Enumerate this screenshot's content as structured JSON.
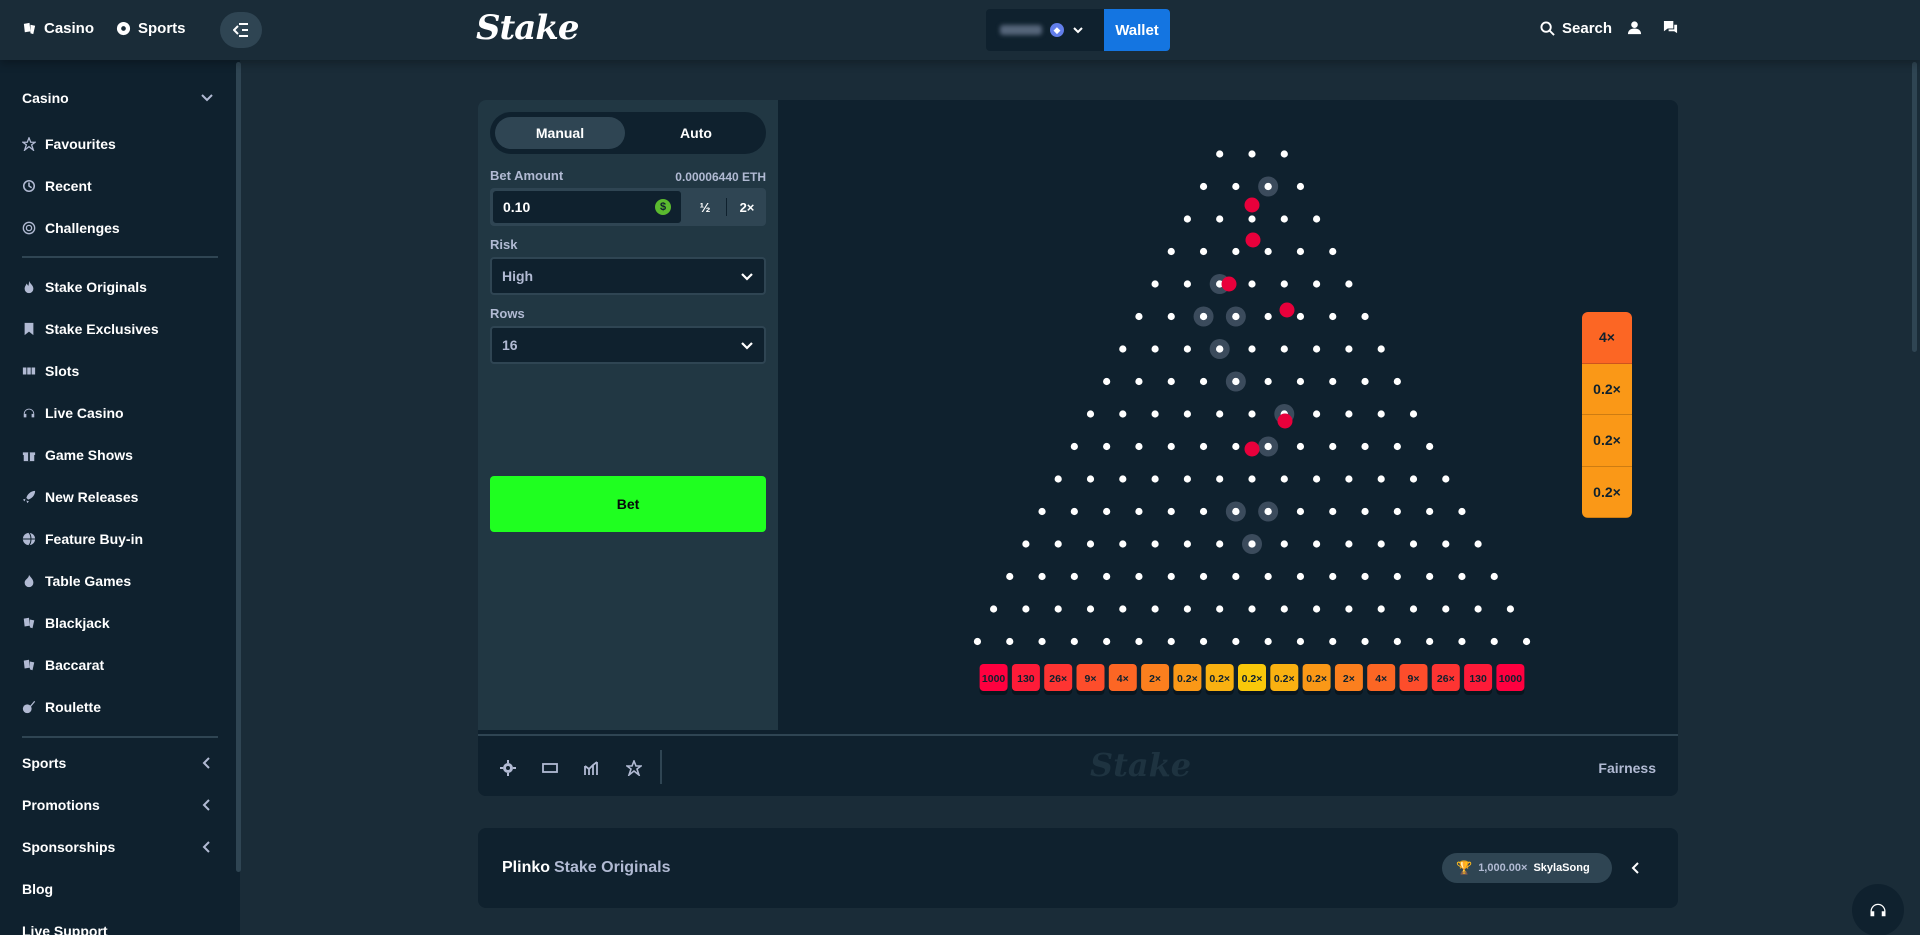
{
  "topbar": {
    "casino_label": "Casino",
    "sports_label": "Sports",
    "logo_text": "Stake",
    "wallet_label": "Wallet",
    "search_label": "Search"
  },
  "sidebar": {
    "section_label": "Casino",
    "group1": [
      {
        "label": "Favourites",
        "icon": "star-icon"
      },
      {
        "label": "Recent",
        "icon": "clock-icon"
      },
      {
        "label": "Challenges",
        "icon": "target-icon"
      }
    ],
    "group2": [
      {
        "label": "Stake Originals",
        "icon": "fire-icon"
      },
      {
        "label": "Stake Exclusives",
        "icon": "bookmark-icon"
      },
      {
        "label": "Slots",
        "icon": "slots-icon"
      },
      {
        "label": "Live Casino",
        "icon": "headset-icon"
      },
      {
        "label": "Game Shows",
        "icon": "gift-icon"
      },
      {
        "label": "New Releases",
        "icon": "rocket-icon"
      },
      {
        "label": "Feature Buy-in",
        "icon": "globe-icon"
      },
      {
        "label": "Table Games",
        "icon": "flame-icon"
      },
      {
        "label": "Blackjack",
        "icon": "cards-icon"
      },
      {
        "label": "Baccarat",
        "icon": "cards-icon"
      },
      {
        "label": "Roulette",
        "icon": "roulette-icon"
      }
    ],
    "group3": [
      {
        "label": "Sports"
      },
      {
        "label": "Promotions"
      },
      {
        "label": "Sponsorships"
      },
      {
        "label": "Blog"
      },
      {
        "label": "Live Support"
      }
    ]
  },
  "bet_panel": {
    "mode_manual": "Manual",
    "mode_auto": "Auto",
    "bet_amount_label": "Bet Amount",
    "bet_amount_crypto": "0.00006440 ETH",
    "bet_amount_value": "0.10",
    "coin_symbol": "$",
    "half_label": "½",
    "double_label": "2×",
    "risk_label": "Risk",
    "risk_value": "High",
    "rows_label": "Rows",
    "rows_value": "16",
    "bet_button": "Bet"
  },
  "plinko": {
    "rows": 16,
    "multipliers": [
      "1000",
      "130",
      "26×",
      "9×",
      "4×",
      "2×",
      "0.2×",
      "0.2×",
      "0.2×",
      "0.2×",
      "0.2×",
      "2×",
      "4×",
      "9×",
      "26×",
      "130",
      "1000"
    ],
    "multiplier_colors": [
      "#ff003f",
      "#fe1b38",
      "#fe3432",
      "#fd4d2b",
      "#fc6624",
      "#fb7f1e",
      "#fa9817",
      "#f9b111",
      "#f9c80a",
      "#f9b111",
      "#fa9817",
      "#fb7f1e",
      "#fc6624",
      "#fd4d2b",
      "#fe3432",
      "#fe1b38",
      "#ff003f"
    ],
    "ball_color": "#e8003b",
    "history": [
      {
        "label": "4×",
        "color": "#fc6624"
      },
      {
        "label": "0.2×",
        "color": "#fa9817"
      },
      {
        "label": "0.2×",
        "color": "#fa9817"
      },
      {
        "label": "0.2×",
        "color": "#fa9817"
      }
    ]
  },
  "footer": {
    "watermark": "Stake",
    "fairness_label": "Fairness"
  },
  "info_bar": {
    "game_title": "Plinko",
    "game_provider": "Stake Originals",
    "top_win_amount": "1,000.00×",
    "top_win_user": "SkylaSong"
  }
}
